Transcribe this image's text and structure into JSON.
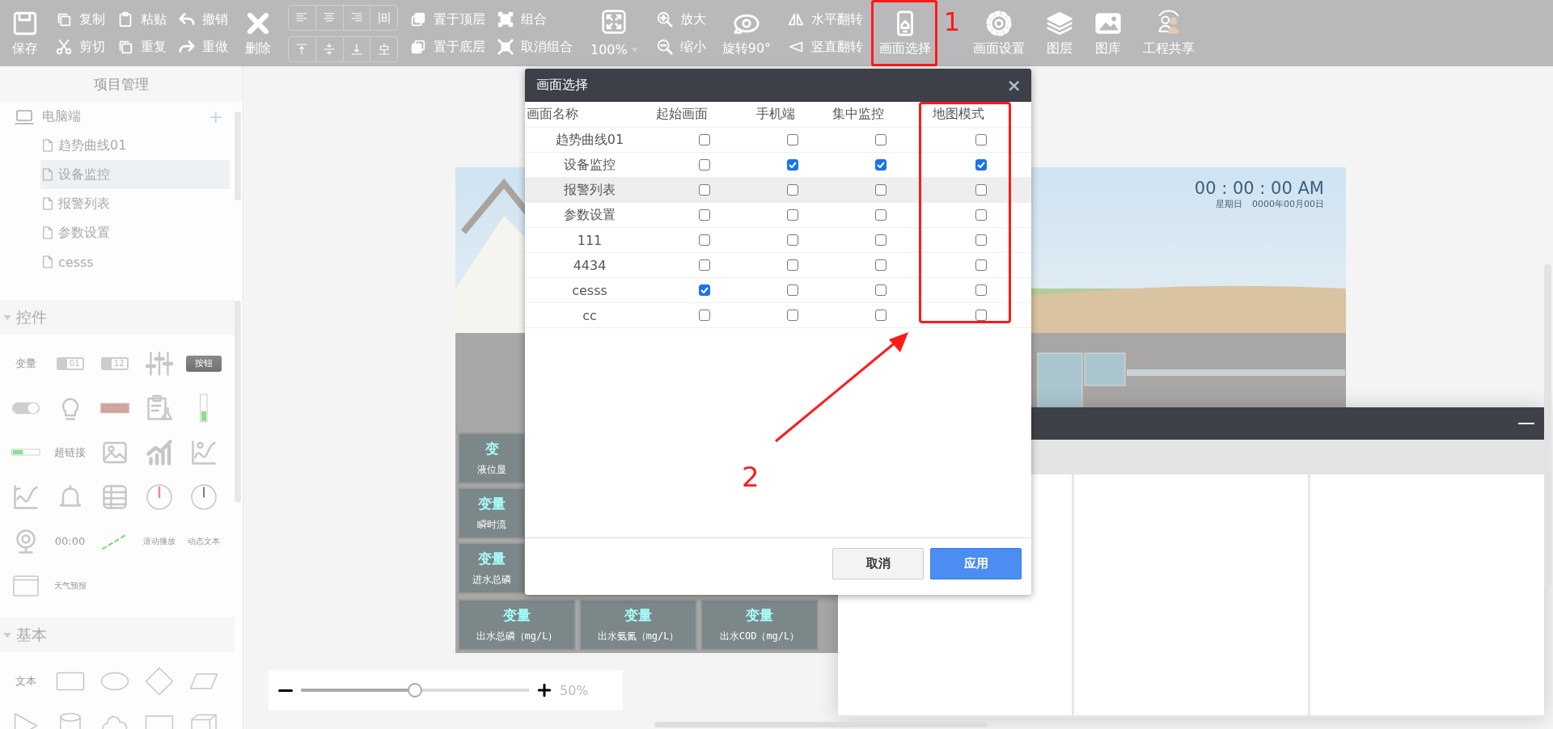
{
  "toolbar": [
    {
      "kind": "big",
      "label": "保存"
    },
    {
      "kind": "pair",
      "items": [
        "复制",
        "剪切"
      ]
    },
    {
      "kind": "pair",
      "items": [
        "粘贴",
        "重复"
      ]
    },
    {
      "kind": "pair",
      "items": [
        "撤销",
        "重做"
      ]
    },
    {
      "kind": "big",
      "label": "删除"
    },
    {
      "kind": "align"
    },
    {
      "kind": "pair",
      "items": [
        "置于顶层",
        "置于底层"
      ]
    },
    {
      "kind": "pair",
      "items": [
        "组合",
        "取消组合"
      ]
    },
    {
      "kind": "zoom",
      "label": "100%"
    },
    {
      "kind": "pair",
      "items": [
        "放大",
        "缩小"
      ]
    },
    {
      "kind": "big",
      "label": "旋转90°"
    },
    {
      "kind": "pair",
      "items": [
        "水平翻转",
        "竖直翻转"
      ]
    },
    {
      "kind": "big",
      "label": "画面选择",
      "annotation": "1"
    },
    {
      "kind": "big",
      "label": "画面设置"
    },
    {
      "kind": "big",
      "label": "图层"
    },
    {
      "kind": "big",
      "label": "图库"
    },
    {
      "kind": "big",
      "label": "工程共享"
    }
  ],
  "project_panel": {
    "title": "项目管理",
    "tree": [
      {
        "label": "电脑端",
        "add": "+",
        "children": [
          {
            "label": "趋势曲线01",
            "selected": false
          },
          {
            "label": "设备监控",
            "selected": true
          },
          {
            "label": "报警列表",
            "selected": false
          },
          {
            "label": "参数设置",
            "selected": false
          },
          {
            "label": "cesss",
            "selected": false
          }
        ]
      }
    ]
  },
  "sections": [
    {
      "title": "控件",
      "expanded": true,
      "items": [
        {
          "kind": "label",
          "text": "变量"
        },
        {
          "kind": "chip",
          "text": "01"
        },
        {
          "kind": "chip",
          "text": "12"
        },
        {
          "kind": "icon"
        },
        {
          "kind": "button",
          "text": "按钮"
        },
        {
          "kind": "icon"
        },
        {
          "kind": "icon"
        },
        {
          "kind": "icon"
        },
        {
          "kind": "icon"
        },
        {
          "kind": "icon"
        },
        {
          "kind": "icon"
        },
        {
          "kind": "label",
          "text": "超链接"
        },
        {
          "kind": "icon"
        },
        {
          "kind": "icon"
        },
        {
          "kind": "icon"
        },
        {
          "kind": "icon"
        },
        {
          "kind": "icon"
        },
        {
          "kind": "icon"
        },
        {
          "kind": "icon"
        },
        {
          "kind": "icon"
        },
        {
          "kind": "icon"
        },
        {
          "kind": "label",
          "text": "00:00"
        },
        {
          "kind": "icon"
        },
        {
          "kind": "caption",
          "text": "滚动播放"
        },
        {
          "kind": "caption",
          "text": "动态文本"
        },
        {
          "kind": "icon"
        },
        {
          "kind": "caption",
          "text": "天气预报"
        }
      ]
    },
    {
      "title": "基本",
      "expanded": true,
      "items": [
        {
          "kind": "label",
          "text": "文本"
        },
        {
          "kind": "icon"
        },
        {
          "kind": "icon"
        },
        {
          "kind": "icon"
        },
        {
          "kind": "icon"
        },
        {
          "kind": "icon"
        },
        {
          "kind": "icon"
        },
        {
          "kind": "icon"
        },
        {
          "kind": "icon"
        },
        {
          "kind": "icon"
        }
      ]
    }
  ],
  "canvas": {
    "clock_time": "00 : 00 : 00 AM",
    "clock_day": "星期日",
    "clock_date": "0000年00月00日",
    "tiles": [
      {
        "value": "变",
        "label": "液位显"
      },
      {
        "value": "变量",
        "label": "瞬时流"
      },
      {
        "value": "变量",
        "label": "进水总磷"
      },
      {
        "value": "变量",
        "label": "出水总磷（mg/L）"
      },
      {
        "value": "变量",
        "label": "出水氨氮（mg/L）"
      },
      {
        "value": "变量",
        "label": "出水COD（mg/L）"
      }
    ]
  },
  "zoom": {
    "level": 0.5,
    "reading": "50%"
  },
  "dialog": {
    "title": "画面选择",
    "close": "×",
    "annotation": "2",
    "columns": [
      {
        "label": "画面名称",
        "annotated": false
      },
      {
        "label": "起始画面",
        "annotated": false
      },
      {
        "label": "手机端",
        "annotated": false
      },
      {
        "label": "集中监控",
        "annotated": false
      },
      {
        "label": "地图模式",
        "annotated": true
      }
    ],
    "rows": [
      {
        "name": "趋势曲线01",
        "start": false,
        "mobile": false,
        "central": false,
        "map": false,
        "hovered": false
      },
      {
        "name": "设备监控",
        "start": false,
        "mobile": true,
        "central": true,
        "map": true,
        "hovered": false
      },
      {
        "name": "报警列表",
        "start": false,
        "mobile": false,
        "central": false,
        "map": false,
        "hovered": true
      },
      {
        "name": "参数设置",
        "start": false,
        "mobile": false,
        "central": false,
        "map": false,
        "hovered": false
      },
      {
        "name": "111",
        "start": false,
        "mobile": false,
        "central": false,
        "map": false,
        "hovered": false
      },
      {
        "name": "4434",
        "start": false,
        "mobile": false,
        "central": false,
        "map": false,
        "hovered": false
      },
      {
        "name": "cesss",
        "start": true,
        "mobile": false,
        "central": false,
        "map": false,
        "hovered": false
      },
      {
        "name": "cc",
        "start": false,
        "mobile": false,
        "central": false,
        "map": false,
        "hovered": false
      }
    ],
    "buttons": [
      {
        "label": "取消",
        "kind": "secondary"
      },
      {
        "label": "应用",
        "kind": "primary"
      }
    ]
  }
}
